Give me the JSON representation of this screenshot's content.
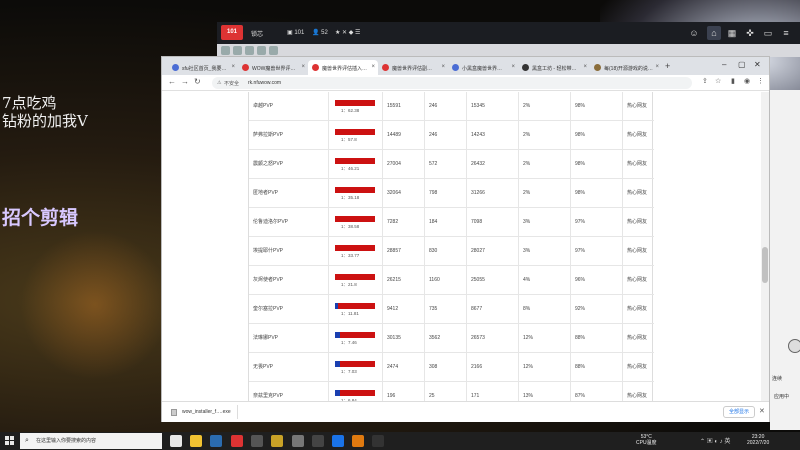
{
  "overlay": {
    "line1": "7点吃鸡",
    "line2": "钻粉的加我V",
    "line3": "招个剪辑",
    "right_text_1": "连续",
    "right_text_2": "应用中"
  },
  "appbar": {
    "logo": "101",
    "title": "锁芯",
    "badge_count": "101",
    "user_count": "52"
  },
  "browser": {
    "tabs": [
      {
        "label": "sfu社区首页_我要…",
        "active": false,
        "color": "#4a6cd4"
      },
      {
        "label": "WOW魔兽世界评…",
        "active": false,
        "color": "#d33"
      },
      {
        "label": "魔兽世界评估插入…",
        "active": true,
        "color": "#d33"
      },
      {
        "label": "魔兽世界评估副…",
        "active": false,
        "color": "#d33"
      },
      {
        "label": "小黑盒魔兽世界…",
        "active": false,
        "color": "#4a6cd4"
      },
      {
        "label": "黑盒工坊 - 轻松带…",
        "active": false,
        "color": "#333"
      },
      {
        "label": "每(18)开源游戏的说…",
        "active": false,
        "color": "#8a6d3b"
      }
    ],
    "security_label": "不安全",
    "url": "rk.nfuwow.com"
  },
  "table": {
    "rows": [
      {
        "name": "卓越PVP",
        "ratio": "1：62.38",
        "blue": 0.0,
        "total": "15591",
        "a": "246",
        "b": "15345",
        "p1": "2%",
        "p2": "98%",
        "tag": "热心网友"
      },
      {
        "name": "萨弗拉斯PVP",
        "ratio": "1：57.8",
        "blue": 0.0,
        "total": "14489",
        "a": "246",
        "b": "14243",
        "p1": "2%",
        "p2": "98%",
        "tag": "热心网友"
      },
      {
        "name": "震颤之怒PVP",
        "ratio": "1：46.21",
        "blue": 0.0,
        "total": "27004",
        "a": "572",
        "b": "26432",
        "p1": "2%",
        "p2": "98%",
        "tag": "热心网友"
      },
      {
        "name": "匿地者PVP",
        "ratio": "1：35.18",
        "blue": 0.0,
        "total": "32064",
        "a": "798",
        "b": "31266",
        "p1": "2%",
        "p2": "98%",
        "tag": "热心网友"
      },
      {
        "name": "伦鲁迪洛尔PVP",
        "ratio": "1：38.58",
        "blue": 0.0,
        "total": "7282",
        "a": "184",
        "b": "7098",
        "p1": "3%",
        "p2": "97%",
        "tag": "热心网友"
      },
      {
        "name": "埃提耶什PVP",
        "ratio": "1：33.77",
        "blue": 0.0,
        "total": "28857",
        "a": "830",
        "b": "28027",
        "p1": "3%",
        "p2": "97%",
        "tag": "热心网友"
      },
      {
        "name": "灰烬使者PVP",
        "ratio": "1：21.8",
        "blue": 0.0,
        "total": "26215",
        "a": "1160",
        "b": "25055",
        "p1": "4%",
        "p2": "96%",
        "tag": "热心网友"
      },
      {
        "name": "奎尔塞拉PVP",
        "ratio": "1：11.81",
        "blue": 0.08,
        "total": "9412",
        "a": "735",
        "b": "8677",
        "p1": "8%",
        "p2": "92%",
        "tag": "热心网友"
      },
      {
        "name": "法琳娜PVP",
        "ratio": "1：7.46",
        "blue": 0.12,
        "total": "30135",
        "a": "3562",
        "b": "26573",
        "p1": "12%",
        "p2": "88%",
        "tag": "热心网友"
      },
      {
        "name": "无畏PVP",
        "ratio": "1：7.03",
        "blue": 0.12,
        "total": "2474",
        "a": "308",
        "b": "2166",
        "p1": "12%",
        "p2": "88%",
        "tag": "热心网友"
      },
      {
        "name": "奈兹里克PVP",
        "ratio": "1：6.84",
        "blue": 0.13,
        "total": "196",
        "a": "25",
        "b": "171",
        "p1": "13%",
        "p2": "87%",
        "tag": "热心网友"
      }
    ]
  },
  "download": {
    "filename": "wow_installer_f….exe",
    "show_all": "全部显示"
  },
  "taskbar": {
    "search_placeholder": "在这里输入你要搜索的内容",
    "temp": "53°C",
    "temp_label": "CPU温度",
    "time": "23:20",
    "date": "2022/7/20"
  }
}
